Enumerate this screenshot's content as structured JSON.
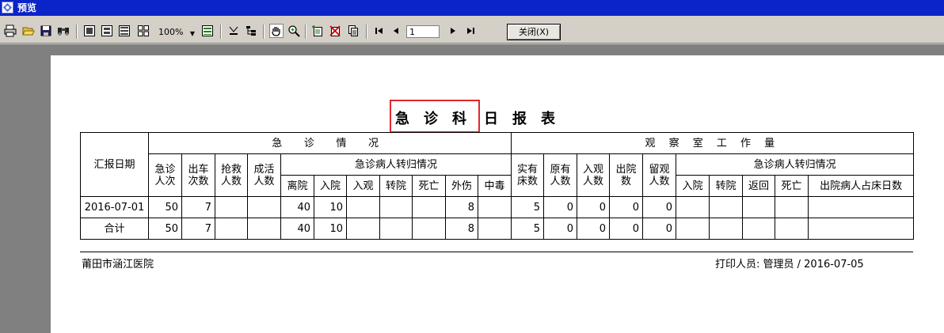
{
  "window": {
    "title": "预览"
  },
  "toolbar": {
    "icons": [
      "print-icon",
      "open-icon",
      "save-icon",
      "find-icon",
      "single-page-icon",
      "two-page-icon",
      "four-page-icon",
      "multi-page-icon",
      "page-width-icon",
      "settings-icon",
      "tree-icon",
      "hand-icon",
      "zoom-icon",
      "edit-page-icon",
      "delete-page-icon",
      "copy-page-icon",
      "first-page-icon",
      "prev-page-icon",
      "next-page-icon",
      "last-page-icon"
    ],
    "zoom": "100%",
    "page": "1",
    "close_label": "关闭(X)"
  },
  "report": {
    "title_chars": [
      "急",
      "诊",
      "科",
      "日",
      "报",
      "表"
    ],
    "header": {
      "report_date": "汇报日期",
      "emergency_group": "急  诊  情  况",
      "observation_group": "观 察 室 工 作 量",
      "transfer_group_1": "急诊病人转归情况",
      "transfer_group_2": "急诊病人转归情况",
      "cols_emergency": [
        "急诊人次",
        "出车次数",
        "抢救人数",
        "成活人数"
      ],
      "cols_transfer_1": [
        "离院",
        "入院",
        "入观",
        "转院",
        "死亡",
        "外伤",
        "中毒"
      ],
      "cols_observation": [
        "实有床数",
        "原有人数",
        "入观人数",
        "出院数",
        "留观人数"
      ],
      "cols_transfer_2": [
        "入院",
        "转院",
        "返回",
        "死亡",
        "出院病人占床日数"
      ]
    },
    "rows": [
      {
        "date": "2016-07-01",
        "cells": [
          "50",
          "7",
          "",
          "",
          "40",
          "10",
          "",
          "",
          "",
          "8",
          "",
          "5",
          "0",
          "0",
          "0",
          "0",
          "",
          "",
          "",
          "",
          ""
        ]
      },
      {
        "date": "合计",
        "cells": [
          "50",
          "7",
          "",
          "",
          "40",
          "10",
          "",
          "",
          "",
          "8",
          "",
          "5",
          "0",
          "0",
          "0",
          "0",
          "",
          "",
          "",
          "",
          ""
        ]
      }
    ],
    "footer_left": "莆田市涵江医院",
    "footer_right": "打印人员: 管理员 / 2016-07-05"
  },
  "colors": {
    "title_bar": "#0a24c8",
    "highlight": "#e0282e",
    "gray_area": "#808080"
  }
}
